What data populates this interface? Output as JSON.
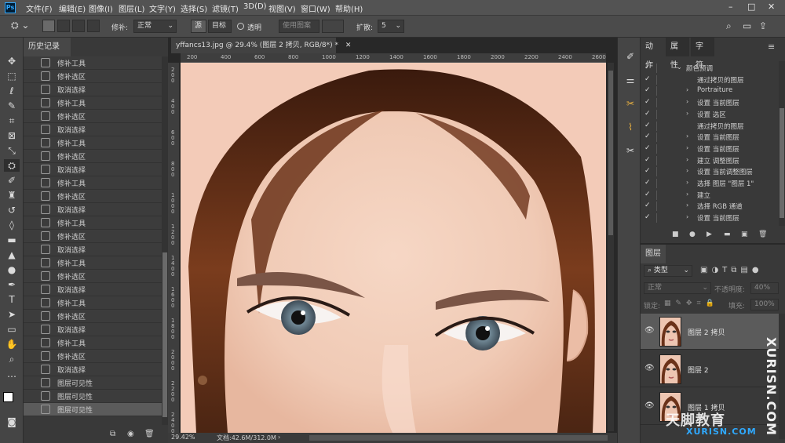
{
  "app": {
    "logo": "Ps"
  },
  "menubar": {
    "items": [
      "文件(F)",
      "编辑(E)",
      "图像(I)",
      "图层(L)",
      "文字(Y)",
      "选择(S)",
      "滤镜(T)",
      "3D(D)",
      "视图(V)",
      "窗口(W)",
      "帮助(H)"
    ],
    "window_controls": [
      "–",
      "□",
      "✕"
    ]
  },
  "options": {
    "repair_label": "修补:",
    "repair_value": "正常",
    "source_label": "源",
    "target_label": "目标",
    "transparent_label": "透明",
    "use_pattern_label": "使用图案",
    "diffusion_label": "扩散:",
    "diffusion_value": "5"
  },
  "history": {
    "tab": "历史记录",
    "items": [
      {
        "label": "修补工具"
      },
      {
        "label": "修补选区"
      },
      {
        "label": "取消选择"
      },
      {
        "label": "修补工具"
      },
      {
        "label": "修补选区"
      },
      {
        "label": "取消选择"
      },
      {
        "label": "修补工具"
      },
      {
        "label": "修补选区"
      },
      {
        "label": "取消选择"
      },
      {
        "label": "修补工具"
      },
      {
        "label": "修补选区"
      },
      {
        "label": "取消选择"
      },
      {
        "label": "修补工具"
      },
      {
        "label": "修补选区"
      },
      {
        "label": "取消选择"
      },
      {
        "label": "修补工具"
      },
      {
        "label": "修补选区"
      },
      {
        "label": "取消选择"
      },
      {
        "label": "修补工具"
      },
      {
        "label": "修补选区"
      },
      {
        "label": "取消选择"
      },
      {
        "label": "修补工具"
      },
      {
        "label": "修补选区"
      },
      {
        "label": "取消选择"
      },
      {
        "label": "图层可见性"
      },
      {
        "label": "图层可见性"
      },
      {
        "label": "图层可见性"
      }
    ]
  },
  "document": {
    "tab_title": "yffancs13.jpg @ 29.4% (图层 2 拷贝, RGB/8*) *",
    "zoom": "29.42%",
    "doc_info": "文档:42.6M/312.0M",
    "ruler_top": [
      "200",
      "400",
      "600",
      "800",
      "1000",
      "1200",
      "1400",
      "1600",
      "1800",
      "2000",
      "2200",
      "2400",
      "2600"
    ],
    "ruler_left": [
      "2 0 0",
      "4 0 0",
      "6 0 0",
      "8 0 0",
      "1 0 0 0",
      "1 2 0 0",
      "1 4 0 0",
      "1 6 0 0",
      "1 8 0 0",
      "2 0 0 0",
      "2 2 0 0",
      "2 4 0 0"
    ]
  },
  "actions": {
    "tabs": [
      "动作",
      "属性",
      "字符"
    ],
    "items": [
      {
        "indent": 1,
        "expand": "⌄",
        "label": "颜色预调"
      },
      {
        "indent": 2,
        "expand": "",
        "label": "通过拷贝的图层"
      },
      {
        "indent": 2,
        "expand": "›",
        "label": "Portraiture"
      },
      {
        "indent": 2,
        "expand": "›",
        "label": "设置 当前图层"
      },
      {
        "indent": 2,
        "expand": "›",
        "label": "设置 选区"
      },
      {
        "indent": 2,
        "expand": "",
        "label": "通过拷贝的图层"
      },
      {
        "indent": 2,
        "expand": "›",
        "label": "设置 当前图层"
      },
      {
        "indent": 2,
        "expand": "›",
        "label": "设置 当前图层"
      },
      {
        "indent": 2,
        "expand": "›",
        "label": "建立 调整图层"
      },
      {
        "indent": 2,
        "expand": "›",
        "label": "设置 当前调整图层"
      },
      {
        "indent": 2,
        "expand": "›",
        "label": "选择 图层 \"图层 1\""
      },
      {
        "indent": 2,
        "expand": "›",
        "label": "建立"
      },
      {
        "indent": 2,
        "expand": "›",
        "label": "选择 RGB 通道"
      },
      {
        "indent": 2,
        "expand": "›",
        "label": "设置 当前图层"
      },
      {
        "indent": 2,
        "expand": "›",
        "label": "设置 当前图层"
      }
    ],
    "bottom_icons": [
      "■",
      "●",
      "▶",
      "▬",
      "▣",
      "🗑"
    ]
  },
  "layers": {
    "tab": "图层",
    "kind_label": "类型",
    "blend_mode": "正常",
    "opacity_label": "不透明度:",
    "opacity_value": "40%",
    "lock_label": "锁定:",
    "fill_label": "填充:",
    "fill_value": "100%",
    "items": [
      {
        "name": "图层 2 拷贝",
        "visible": true,
        "selected": true
      },
      {
        "name": "图层 2",
        "visible": true,
        "selected": false
      },
      {
        "name": "图层 1 拷贝",
        "visible": true,
        "selected": false
      }
    ]
  },
  "watermark": {
    "vertical": "XURISN.COM",
    "brand": "天脚教育",
    "url": "XURISN.COM"
  },
  "colors": {
    "skin": "#f2c9b6",
    "hair": "#5a2c16",
    "accent": "#31a8ff"
  }
}
